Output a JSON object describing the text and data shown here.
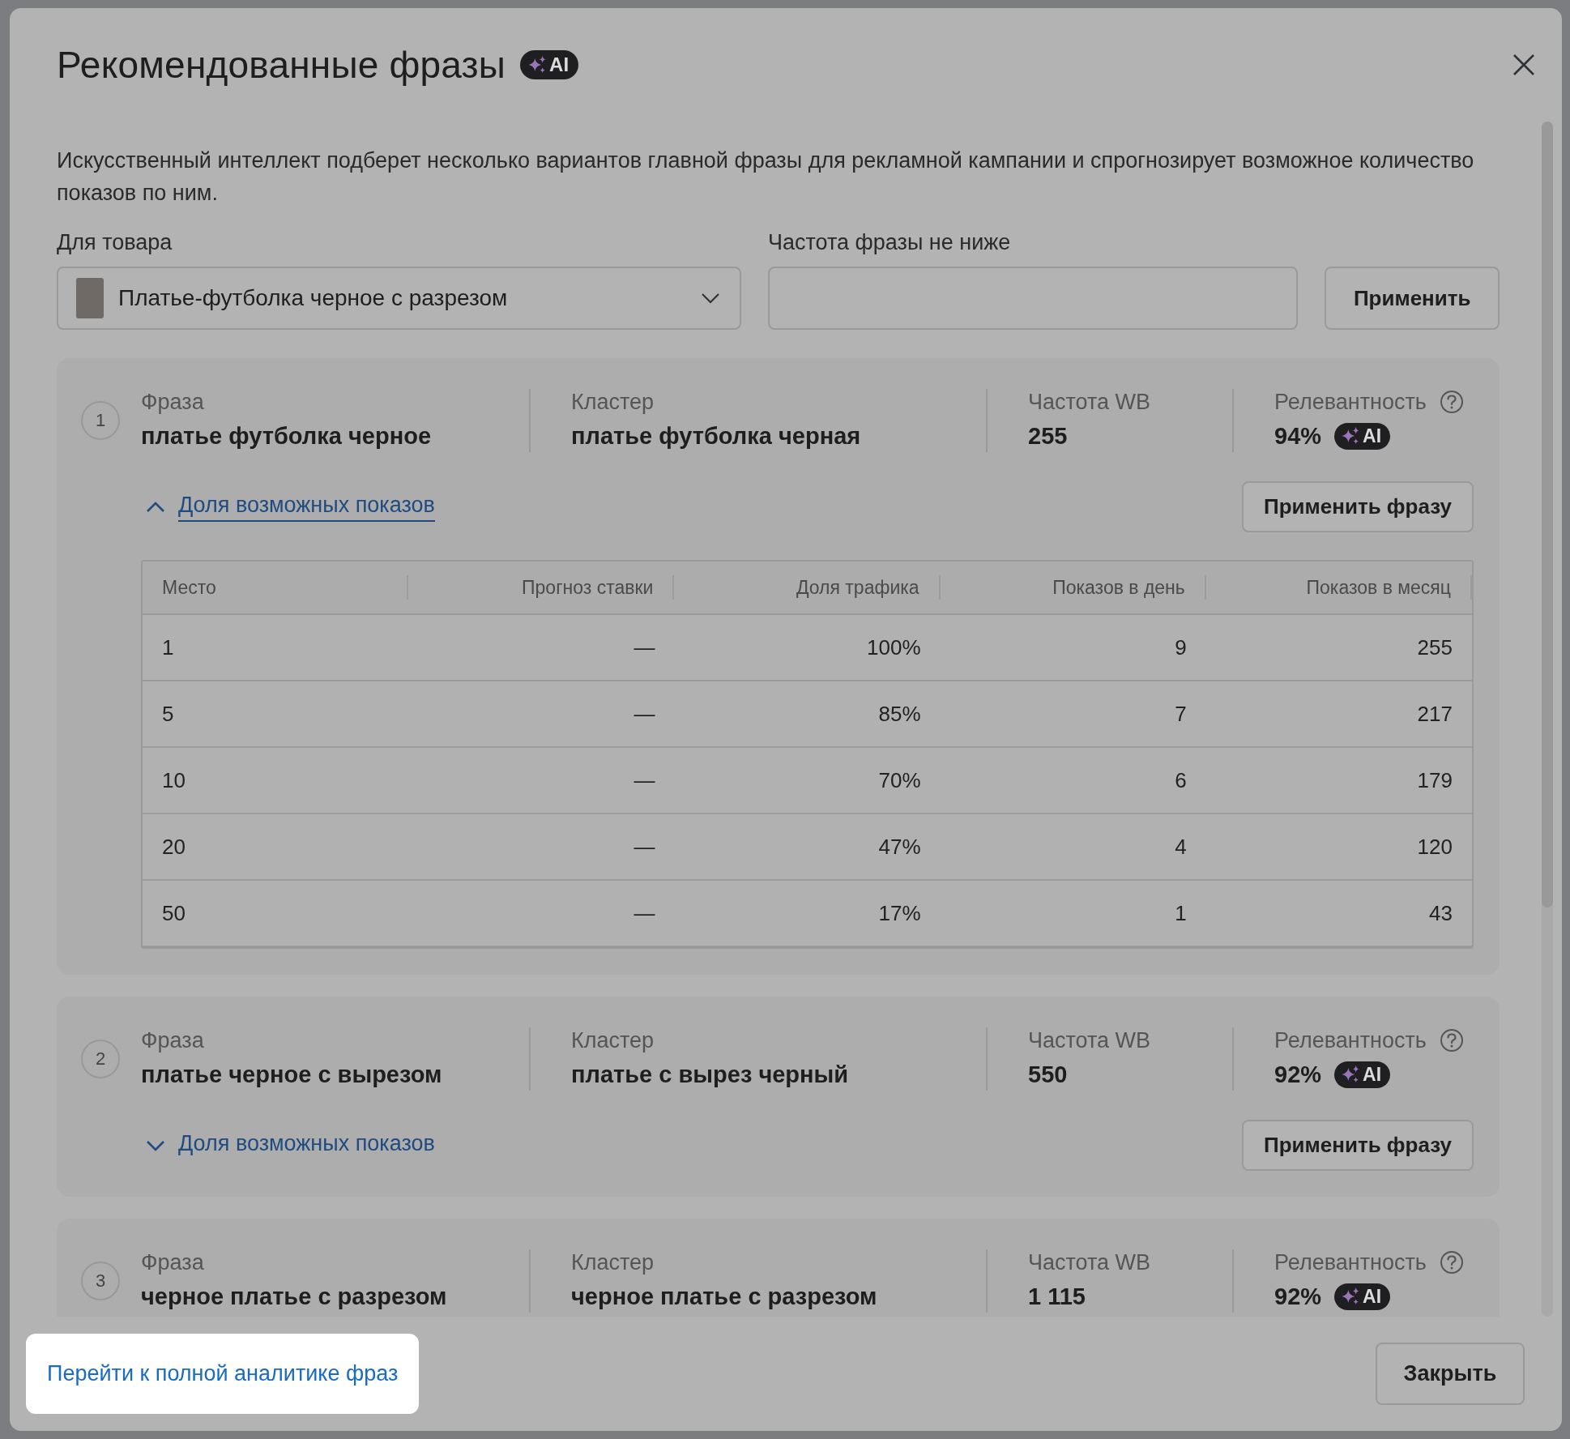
{
  "dialog": {
    "title": "Рекомендованные фразы",
    "title_badge": "AI",
    "description": "Искусственный интеллект подберет несколько вариантов главной фразы для рекламной кампании и спрогнозирует возможное количество показов по ним.",
    "product_field": {
      "label": "Для товара",
      "value": "Платье-футболка черное с разрезом"
    },
    "frequency_field": {
      "label": "Частота фразы не ниже"
    },
    "apply_button": "Применить"
  },
  "cards": [
    {
      "number": "1",
      "phrase_label": "Фраза",
      "phrase": "платье футболка черное",
      "cluster_label": "Кластер",
      "cluster": "платье футболка черная",
      "frequency_label": "Частота WB",
      "frequency": "255",
      "relevance_label": "Релевантность",
      "relevance": "94%",
      "relevance_badge": "AI",
      "toggle": "Доля возможных показов",
      "expanded": true,
      "apply_button": "Применить фразу",
      "table": {
        "columns": [
          "Место",
          "Прогноз ставки",
          "Доля трафика",
          "Показов в день",
          "Показов в месяц"
        ],
        "rows": [
          [
            "1",
            "—",
            "100%",
            "9",
            "255"
          ],
          [
            "5",
            "—",
            "85%",
            "7",
            "217"
          ],
          [
            "10",
            "—",
            "70%",
            "6",
            "179"
          ],
          [
            "20",
            "—",
            "47%",
            "4",
            "120"
          ],
          [
            "50",
            "—",
            "17%",
            "1",
            "43"
          ]
        ]
      }
    },
    {
      "number": "2",
      "phrase_label": "Фраза",
      "phrase": "платье черное с вырезом",
      "cluster_label": "Кластер",
      "cluster": "платье с вырез черный",
      "frequency_label": "Частота WB",
      "frequency": "550",
      "relevance_label": "Релевантность",
      "relevance": "92%",
      "relevance_badge": "AI",
      "toggle": "Доля возможных показов",
      "expanded": false,
      "apply_button": "Применить фразу"
    },
    {
      "number": "3",
      "phrase_label": "Фраза",
      "phrase": "черное платье с разрезом",
      "cluster_label": "Кластер",
      "cluster": "черное платье с разрезом",
      "frequency_label": "Частота WB",
      "frequency": "1 115",
      "relevance_label": "Релевантность",
      "relevance": "92%",
      "relevance_badge": "AI"
    }
  ],
  "footer": {
    "link": "Перейти к полной аналитике фраз",
    "close_button": "Закрыть"
  }
}
